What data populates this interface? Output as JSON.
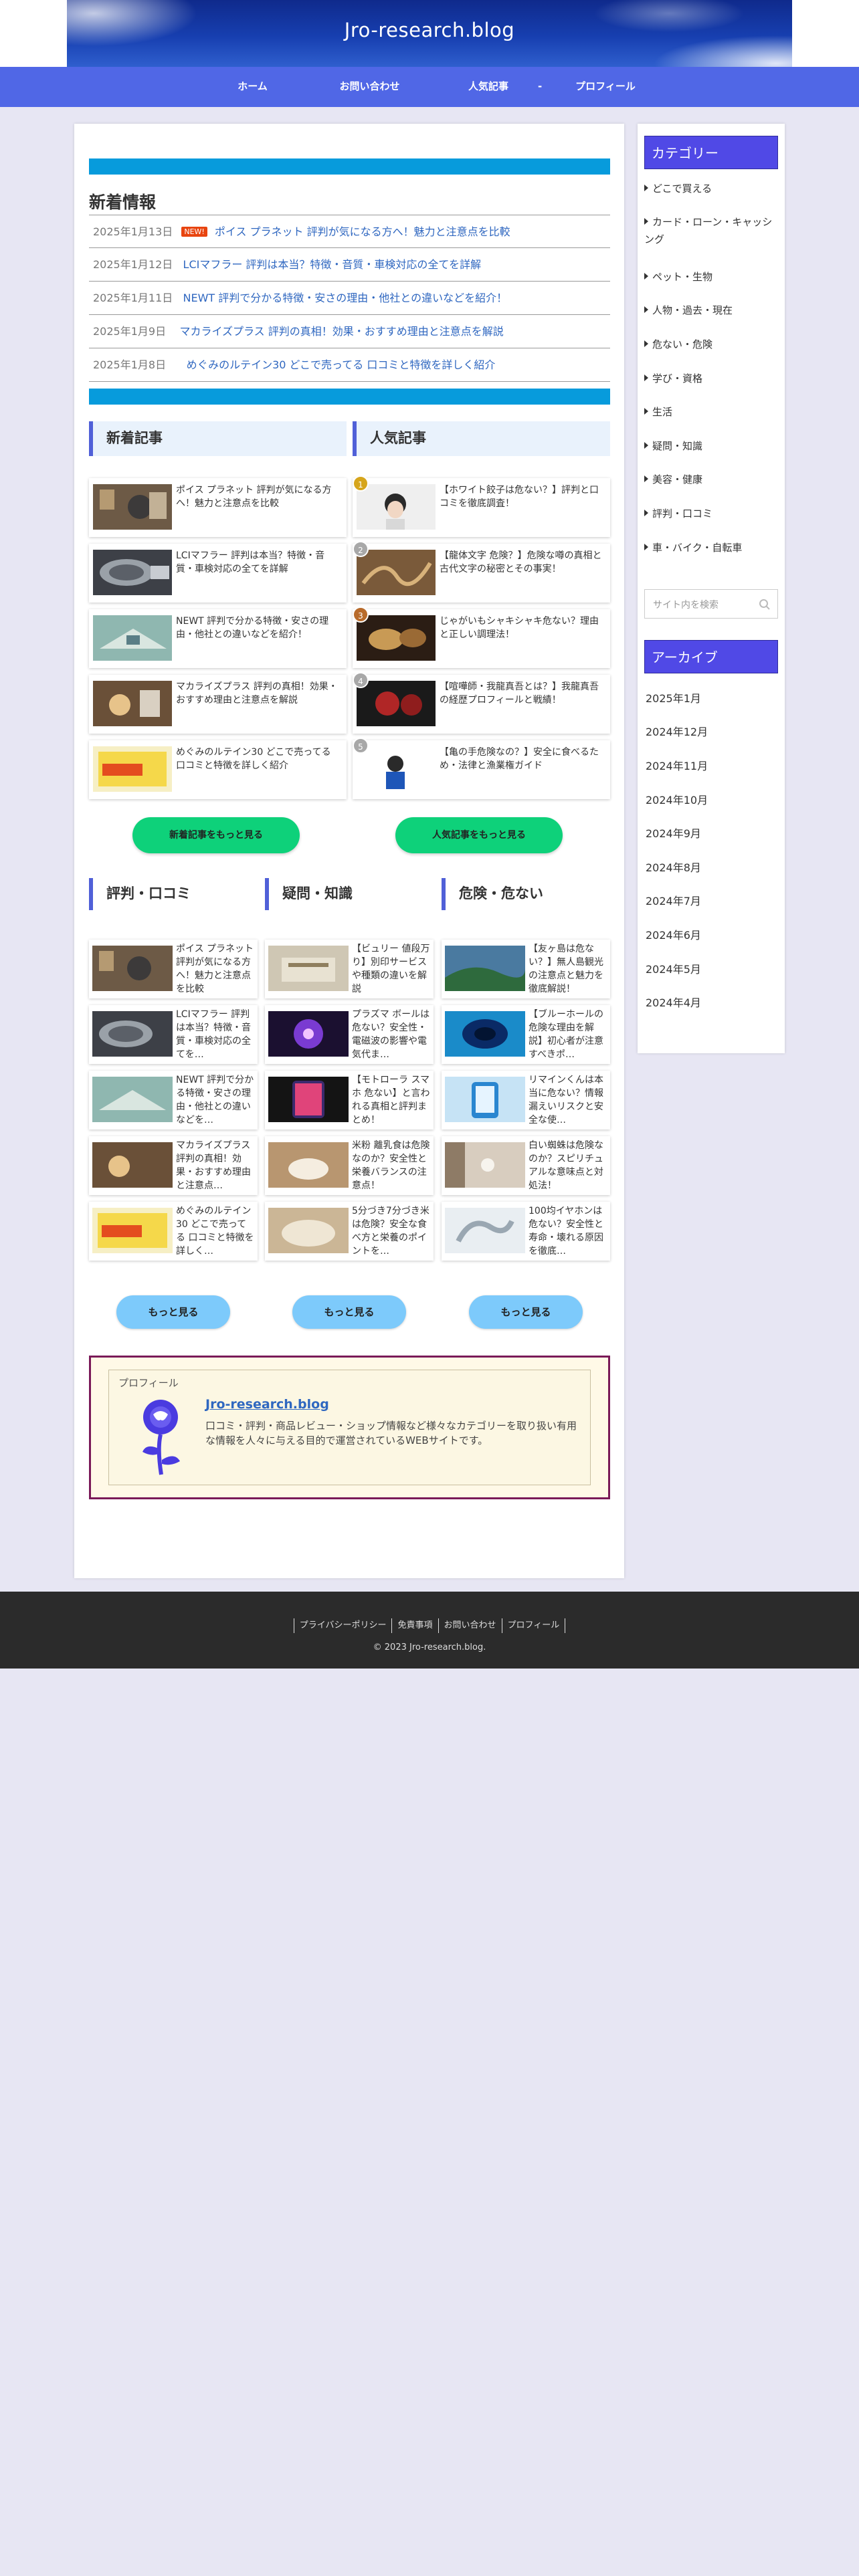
{
  "header": {
    "site_title": "Jro-research.blog"
  },
  "nav": {
    "items": [
      "ホーム",
      "お問い合わせ",
      "人気記事",
      "-",
      "プロフィール"
    ]
  },
  "news": {
    "heading": "新着情報",
    "items": [
      {
        "date": "2025年1月13日",
        "badge": "NEW!",
        "title": "ポイス プラネット 評判が気になる方へ！魅力と注意点を比較"
      },
      {
        "date": "2025年1月12日",
        "title": "LCIマフラー 評判は本当？特徴・音質・車検対応の全てを詳解"
      },
      {
        "date": "2025年1月11日",
        "title": "NEWT 評判で分かる特徴・安さの理由・他社との違いなどを紹介！"
      },
      {
        "date": "2025年1月9日",
        "title": "マカライズプラス 評判の真相！効果・おすすめ理由と注意点を解説"
      },
      {
        "date": "2025年1月8日",
        "title": "めぐみのルテイン30 どこで売ってる 口コミと特徴を詳しく紹介"
      }
    ]
  },
  "latest": {
    "heading": "新着記事",
    "items": [
      "ポイス プラネット 評判が気になる方へ！魅力と注意点を比較",
      "LCIマフラー 評判は本当？特徴・音質・車検対応の全てを詳解",
      "NEWT 評判で分かる特徴・安さの理由・他社との違いなどを紹介！",
      "マカライズプラス 評判の真相！効果・おすすめ理由と注意点を解説",
      "めぐみのルテイン30 どこで売ってる 口コミと特徴を詳しく紹介"
    ],
    "more": "新着記事をもっと見る"
  },
  "popular": {
    "heading": "人気記事",
    "items": [
      {
        "rank": "1",
        "title": "【ホワイト餃子は危ない？】評判と口コミを徹底調査！"
      },
      {
        "rank": "2",
        "title": "【龍体文字 危険？】危険な噂の真相と古代文字の秘密とその事実！"
      },
      {
        "rank": "3",
        "title": "じゃがいもシャキシャキ危ない？理由と正しい調理法！"
      },
      {
        "rank": "4",
        "title": "【喧嘩師・我龍真吾とは？】我龍真吾の経歴プロフィールと戦績！"
      },
      {
        "rank": "5",
        "title": "【亀の手危険なの？】安全に食べるため・法律と漁業権ガイド"
      }
    ],
    "more": "人気記事をもっと見る"
  },
  "columns": [
    {
      "heading": "評判・口コミ",
      "items": [
        "ポイス プラネット 評判が気になる方へ！魅力と注意点を比較",
        "LCIマフラー 評判は本当？特徴・音質・車検対応の全てを…",
        "NEWT 評判で分かる特徴・安さの理由・他社との違いなどを…",
        "マカライズプラス 評判の真相！効果・おすすめ理由と注意点…",
        "めぐみのルテイン30 どこで売ってる 口コミと特徴を詳しく…"
      ],
      "more": "もっと見る"
    },
    {
      "heading": "疑問・知識",
      "items": [
        "【ビュリー 値段万り】別印サービスや種類の違いを解説",
        "プラズマ ボールは危ない？安全性・電磁波の影響や電気代ま…",
        "【モトローラ スマホ 危ない】と言われる真相と評判まとめ！",
        "米粉 離乳食は危険なのか？安全性と栄養バランスの注意点！",
        "5分づき7分づき米は危険？安全な食べ方と栄養のポイントを…"
      ],
      "more": "もっと見る"
    },
    {
      "heading": "危険・危ない",
      "items": [
        "【友ヶ島は危ない？】無人島観光の注意点と魅力を徹底解説！",
        "【ブルーホールの危険な理由を解説】初心者が注意すべきポ…",
        "リマインくんは本当に危ない？情報漏えいリスクと安全な使…",
        "白い蜘蛛は危険なのか？スピリチュアルな意味点と対処法！",
        "100均イヤホンは危ない？安全性と寿命・壊れる原因を徹底…"
      ],
      "more": "もっと見る"
    }
  ],
  "profile": {
    "label": "プロフィール",
    "name": "Jro-research.blog",
    "desc": "口コミ・評判・商品レビュー・ショップ情報など様々なカテゴリーを取り扱い有用な情報を人々に与える目的で運営されているWEBサイトです。"
  },
  "sidebar": {
    "category_heading": "カテゴリー",
    "categories": [
      "どこで買える",
      "カード・ローン・キャッシング",
      "ペット・生物",
      "人物・過去・現在",
      "危ない・危険",
      "学び・資格",
      "生活",
      "疑問・知識",
      "美容・健康",
      "評判・口コミ",
      "車・バイク・自転車"
    ],
    "search_placeholder": "サイト内を検索",
    "archive_heading": "アーカイブ",
    "archives": [
      "2025年1月",
      "2024年12月",
      "2024年11月",
      "2024年10月",
      "2024年9月",
      "2024年8月",
      "2024年7月",
      "2024年6月",
      "2024年5月",
      "2024年4月"
    ]
  },
  "footer": {
    "links": [
      "プライバシーポリシー",
      "免責事項",
      "お問い合わせ",
      "プロフィール"
    ],
    "copyright": "© 2023 Jro-research.blog."
  },
  "colors": {
    "nav": "#5067e6",
    "accent_bar": "#079bdc",
    "side_head": "#5049e6",
    "green_button": "#0ed17a",
    "blue_button": "#7dcafb",
    "footer": "#2b2b2b",
    "rank_gold": "#d6a51c",
    "rank_silver": "#a8a8a8",
    "rank_bronze": "#b86b2b"
  }
}
